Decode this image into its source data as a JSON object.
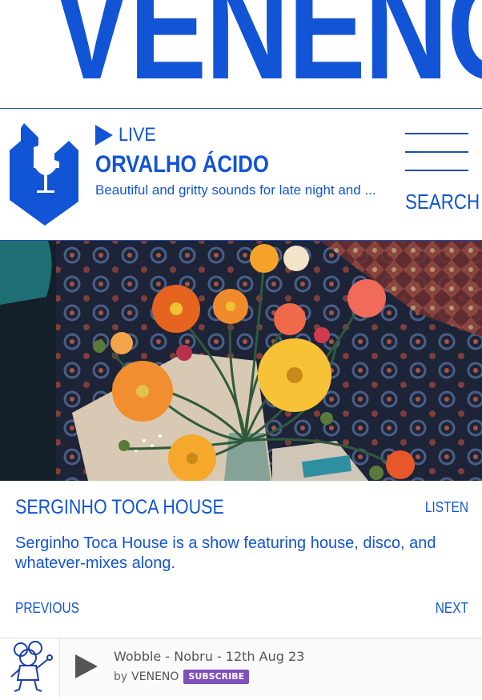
{
  "brand": {
    "title": "VENENO"
  },
  "live": {
    "status_label": "LIVE",
    "show_name": "ORVALHO ÁCIDO",
    "description": "Beautiful and gritty sounds for late night and ..."
  },
  "nav": {
    "menu_icon": "hamburger-menu-icon",
    "search_label": "SEARCH"
  },
  "episode": {
    "title": "SERGINHO TOCA HOUSE",
    "listen_label": "LISTEN",
    "description": "Serginho Toca House is a show featuring house, disco, and whatever-mixes along.",
    "previous_label": "PREVIOUS",
    "next_label": "NEXT"
  },
  "player": {
    "track_title": "Wobble - Nobru - 12th Aug 23",
    "by_word": "by",
    "artist": "VENENO",
    "subscribe_label": "SUBSCRIBE",
    "play_icon": "play-icon"
  },
  "colors": {
    "brand_blue": "#1254d6",
    "rule_blue": "#1f4fae",
    "subscribe_purple": "#7e4fbd"
  }
}
